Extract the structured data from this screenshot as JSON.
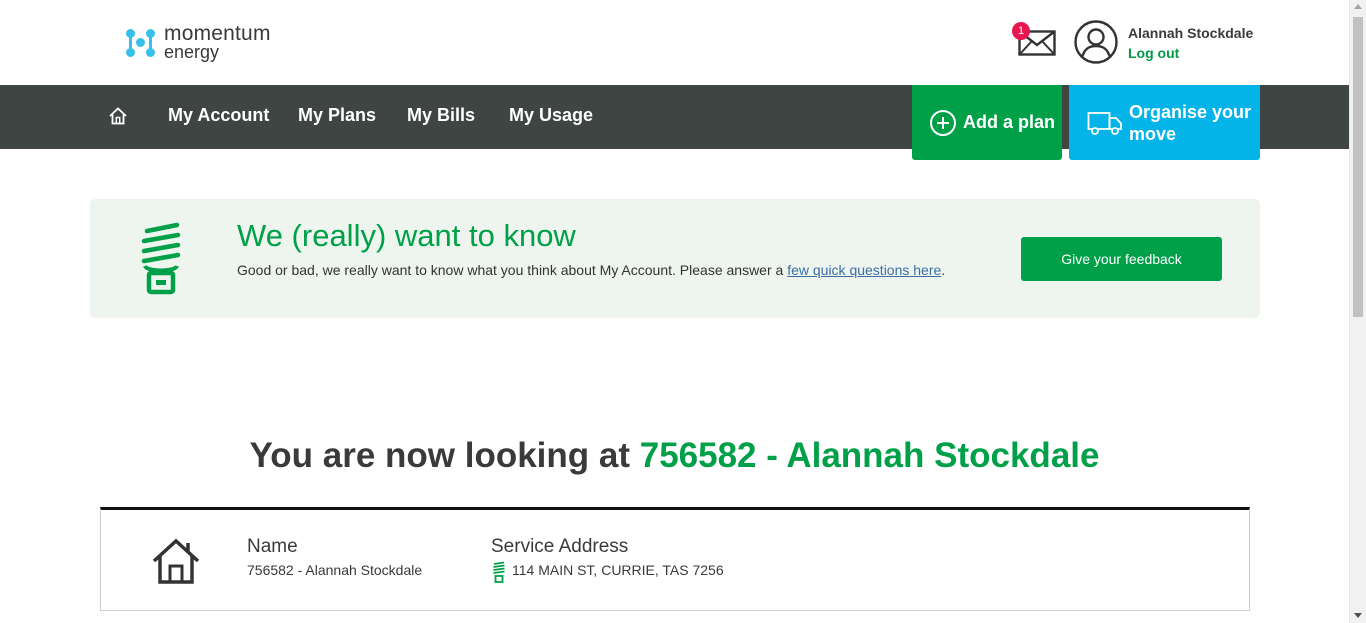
{
  "brand": {
    "line1": "momentum",
    "line2": "energy",
    "accent": "#00a049",
    "logo_color": "#36c1ea"
  },
  "header": {
    "notifications_count": "1",
    "user_name": "Alannah Stockdale",
    "logout_label": "Log out"
  },
  "nav": {
    "items": [
      {
        "label": "My Account"
      },
      {
        "label": "My Plans"
      },
      {
        "label": "My Bills"
      },
      {
        "label": "My Usage"
      }
    ],
    "add_plan_label": "Add a plan",
    "move_label_line1": "Organise your",
    "move_label_line2": "move"
  },
  "feedback": {
    "title": "We (really) want to know",
    "text_before": "Good or bad, we really want to know what you think about My Account. Please answer a ",
    "link_text": "few quick questions here",
    "text_after": ".",
    "button_label": "Give your feedback"
  },
  "looking": {
    "prefix": "You are now looking at ",
    "account": "756582 - Alannah Stockdale"
  },
  "account_card": {
    "name_label": "Name",
    "name_value": "756582 - Alannah Stockdale",
    "address_label": "Service Address",
    "address_value": "114 MAIN ST, CURRIE, TAS 7256"
  }
}
